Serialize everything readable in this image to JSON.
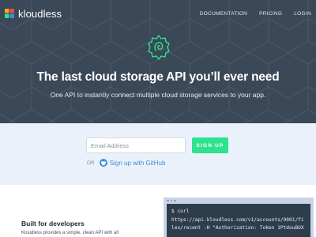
{
  "brand": {
    "name": "kloudless"
  },
  "nav": {
    "links": [
      {
        "label": "DOCUMENTATION"
      },
      {
        "label": "PRICING"
      },
      {
        "label": "LOGIN"
      }
    ]
  },
  "hero": {
    "title": "The last cloud storage API you’ll ever need",
    "subtitle": "One API to instantly connect multiple cloud storage services to your app."
  },
  "signup": {
    "email_placeholder": "Email Address",
    "button_label": "SIGN UP",
    "or_label": "OR",
    "github_label": "Sign up with GitHub"
  },
  "features": {
    "title": "Built for developers",
    "text": "Kloudless provides a simple, clean API with all"
  },
  "terminal": {
    "lines": [
      "$ curl",
      "https://api.kloudless.com/v1/accounts/9001/fi",
      "les/recent -H \"Authorization: Token 1PtdouBUX"
    ]
  },
  "colors": {
    "hero_bg": "#3a4858",
    "accent_green": "#2ee28f",
    "signup_bg": "#eaf1fb",
    "link_blue": "#3e8fd8",
    "terminal_bg": "#2e3d4c"
  },
  "icons": {
    "brand": "kloudless-logo-icon",
    "hero": "kloudless-badge-icon",
    "github": "github-icon"
  }
}
